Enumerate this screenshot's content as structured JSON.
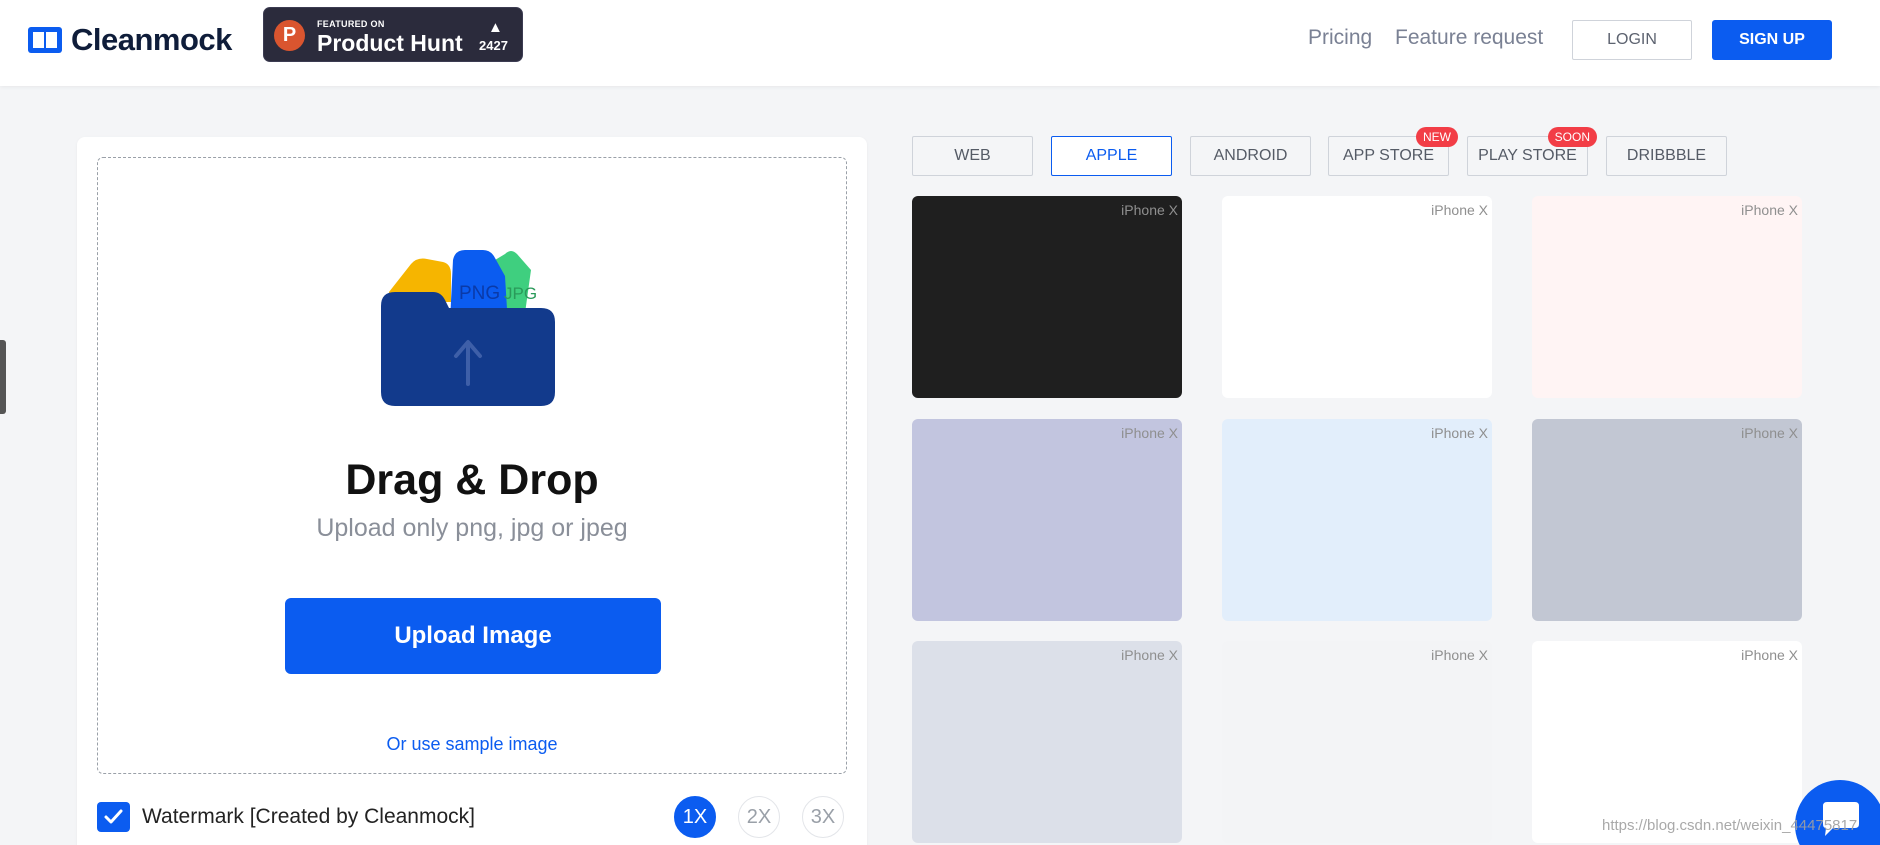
{
  "header": {
    "logo_text": "Cleanmock",
    "product_hunt": {
      "featured": "FEATURED ON",
      "name": "Product Hunt",
      "count": "2427",
      "arrow": "▲",
      "letter": "P"
    },
    "nav": {
      "pricing": "Pricing",
      "feature_request": "Feature request"
    },
    "login": "LOGIN",
    "signup": "SIGN UP"
  },
  "upload": {
    "title": "Drag & Drop",
    "subtitle": "Upload only png, jpg or jpeg",
    "button": "Upload Image",
    "sample_link": "Or use sample image",
    "folder_labels": {
      "png": "PNG",
      "jpg": "JPG"
    }
  },
  "watermark": {
    "label": "Watermark [Created by Cleanmock]",
    "checked": true
  },
  "scales": [
    "1X",
    "2X",
    "3X"
  ],
  "active_scale": "1X",
  "tabs": [
    {
      "label": "WEB"
    },
    {
      "label": "APPLE",
      "active": true
    },
    {
      "label": "ANDROID"
    },
    {
      "label": "APP STORE",
      "badge": "NEW"
    },
    {
      "label": "PLAY STORE",
      "badge": "SOON"
    },
    {
      "label": "DRIBBBLE"
    }
  ],
  "cards": [
    {
      "label": "iPhone X",
      "color": "#1f1f1f"
    },
    {
      "label": "iPhone X",
      "color": "#ffffff"
    },
    {
      "label": "iPhone X",
      "color": "#fff4f4"
    },
    {
      "label": "iPhone X",
      "color": "#c2c5df"
    },
    {
      "label": "iPhone X",
      "color": "#e2eefb"
    },
    {
      "label": "iPhone X",
      "color": "#c2c7d3"
    },
    {
      "label": "iPhone X",
      "color": "#dce0e9"
    },
    {
      "label": "iPhone X",
      "color": "#f3f4f6"
    },
    {
      "label": "iPhone X",
      "color": "#ffffff"
    }
  ],
  "footer_watermark": "https://blog.csdn.net/weixin_44475817",
  "colors": {
    "accent": "#0b5cf0",
    "badge": "#f23d46"
  }
}
